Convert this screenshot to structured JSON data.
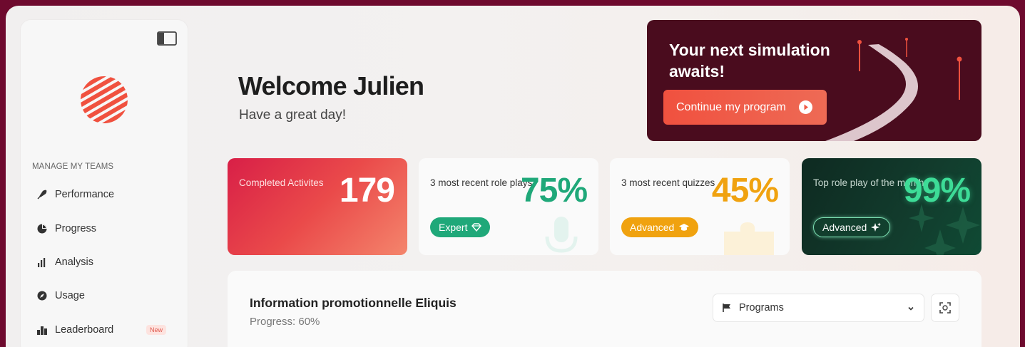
{
  "sidebar": {
    "section_title": "MANAGE MY TEAMS",
    "items": [
      {
        "label": "Performance",
        "icon": "rocket-icon"
      },
      {
        "label": "Progress",
        "icon": "pie-chart-icon"
      },
      {
        "label": "Analysis",
        "icon": "bar-chart-icon"
      },
      {
        "label": "Usage",
        "icon": "compass-icon"
      },
      {
        "label": "Leaderboard",
        "icon": "podium-icon",
        "badge": "New"
      }
    ]
  },
  "welcome": {
    "title": "Welcome Julien",
    "subtitle": "Have a great day!"
  },
  "promo": {
    "title": "Your next simulation awaits!",
    "button_label": "Continue my program"
  },
  "stats": [
    {
      "label": "Completed Activites",
      "value": "179"
    },
    {
      "label": "3 most recent role plays",
      "value": "75%",
      "pill": "Expert"
    },
    {
      "label": "3 most recent quizzes",
      "value": "45%",
      "pill": "Advanced"
    },
    {
      "label": "Top role play of the month",
      "value": "99%",
      "pill": "Advanced"
    }
  ],
  "program_panel": {
    "title": "Information promotionnelle Eliquis",
    "progress_text": "Progress: 60%",
    "progress": 0.6,
    "select_value": "Programs"
  },
  "colors": {
    "accent": "#ef5a45",
    "brand_dark": "#4a0c1e",
    "green": "#1fa879",
    "amber": "#f0a20f"
  }
}
